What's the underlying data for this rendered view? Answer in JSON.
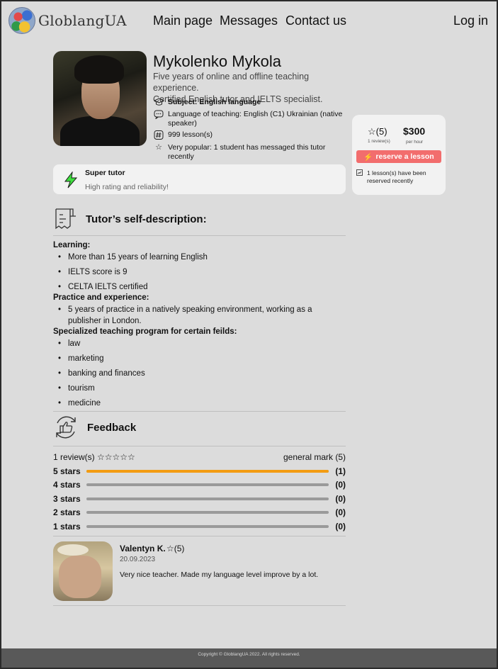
{
  "header": {
    "logo_text": "GloblangUA",
    "nav": [
      "Main page",
      "Messages",
      "Contact us"
    ],
    "login": "Log in"
  },
  "tutor": {
    "name": "Mykolenko Mykola",
    "description_line1": "Five years of online and offline teaching experience.",
    "description_line2": "Certified English tutor and IELTS specialist.",
    "subject": "Subject: English language",
    "languages": "Language of teaching: English (C1) Ukrainian (native speaker)",
    "lessons": "999 lesson(s)",
    "popularity": "Very popular: 1 student has messaged this tutor recently"
  },
  "super_tutor": {
    "title": "Super tutor",
    "subtitle": "High rating and reliability!"
  },
  "price_card": {
    "rating": "☆(5)",
    "reviews": "1 review(s)",
    "price": "$300",
    "per": "per hour",
    "reserve_label": "reserve a lesson",
    "note": "1 lesson(s) have been reserved recently"
  },
  "self_description": {
    "title": "Tutor’s self-description:",
    "learning_title": "Learning:",
    "learning": [
      "More than 15 years of learning English",
      "IELTS score is 9",
      "CELTA IELTS certified"
    ],
    "practice_title": "Practice and experience:",
    "practice": [
      "5 years of practice in a natively speaking environment, working  as a publisher in London."
    ],
    "program_title": "Specialized teaching program for certain feilds:",
    "program": [
      "law",
      "marketing",
      "banking and finances",
      "tourism",
      "medicine"
    ]
  },
  "feedback": {
    "title": "Feedback",
    "reviews_label": "1 review(s) ☆☆☆☆☆",
    "general_mark": "general mark (5)",
    "bars": [
      {
        "label": "5 stars",
        "count": "(1)",
        "fraction": 1.0
      },
      {
        "label": "4 stars",
        "count": "(0)",
        "fraction": 0
      },
      {
        "label": "3 stars",
        "count": "(0)",
        "fraction": 0
      },
      {
        "label": "2 stars",
        "count": "(0)",
        "fraction": 0
      },
      {
        "label": "1 stars",
        "count": "(0)",
        "fraction": 0
      }
    ],
    "review": {
      "name": "Valentyn K.",
      "stars": "☆(5)",
      "date": "20.09.2023",
      "text": "Very nice teacher. Made my language level improve by a lot."
    }
  },
  "footer": "Copyright © GloblangUA 2022. All rights reserved.",
  "colors": {
    "accent_orange": "#f39c12",
    "reserve_red": "#f26d6d",
    "bolt_green": "#3fe03f"
  }
}
